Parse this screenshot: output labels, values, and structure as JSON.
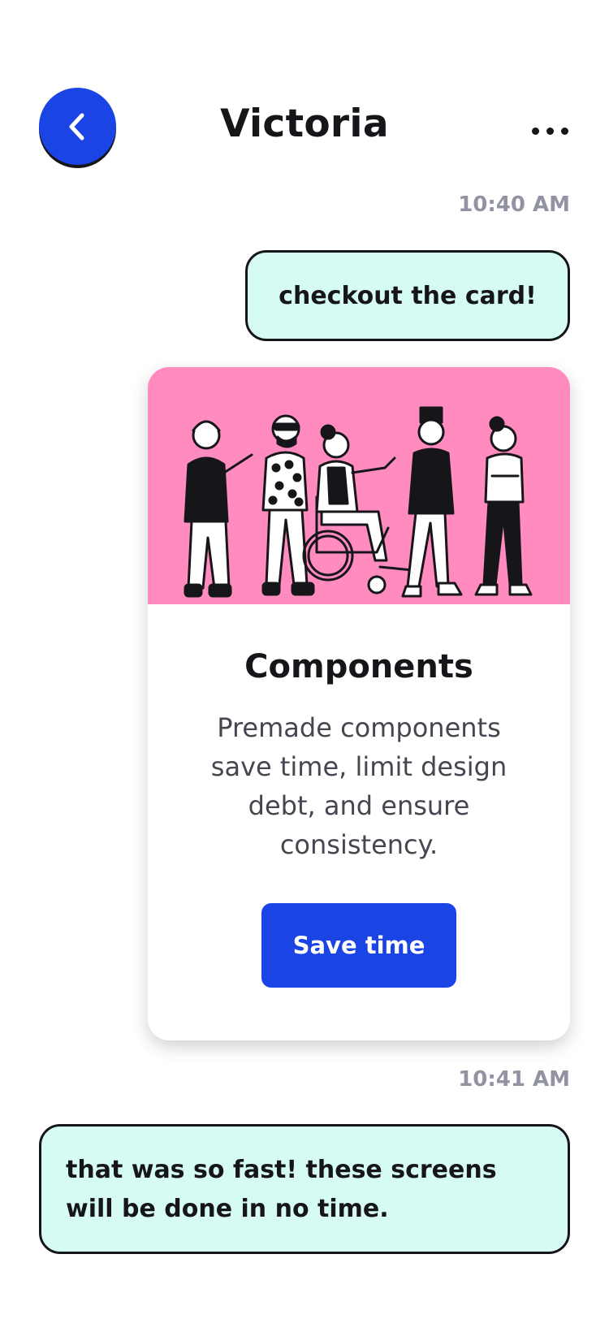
{
  "header": {
    "title": "Victoria",
    "back_icon": "chevron-left-icon",
    "more_icon": "more-horizontal-icon"
  },
  "messages": [
    {
      "timestamp": "10:40 AM",
      "text": "checkout the card!",
      "direction": "outgoing"
    },
    {
      "timestamp": "10:41 AM",
      "text": "that was so fast! these screens will be done in no time.",
      "direction": "incoming"
    }
  ],
  "card": {
    "illustration": "people-group-illustration",
    "title": "Components",
    "description": "Premade components save time, limit design debt, and ensure consistency.",
    "cta_label": "Save time"
  },
  "colors": {
    "accent": "#1a44e4",
    "bubble": "#d6fbf5",
    "illustration_bg": "#ff8bbf",
    "timestamp": "#9193a3"
  }
}
